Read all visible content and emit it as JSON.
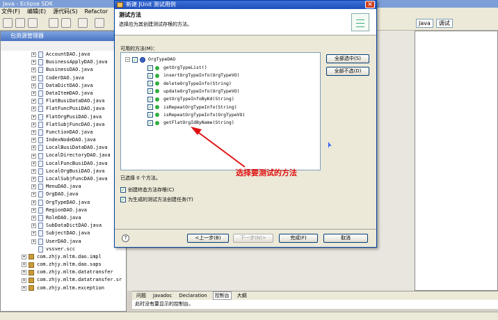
{
  "window": {
    "title": "Java - Eclipse SDK"
  },
  "menubar": [
    "文件(F)",
    "编辑(E)",
    "源代码(S)",
    "Refactor"
  ],
  "perspectives": {
    "java": "Java",
    "debug": "调试"
  },
  "explorer": {
    "tab": "包资源管理器",
    "files": [
      "AccountDAO.java",
      "BusinessApplyDAO.java",
      "BusinessDAO.java",
      "CoderDAO.java",
      "DataDictDAO.java",
      "DataItemDAO.java",
      "FlatBusiDataDAO.java",
      "FlatFuncPusiDAO.java",
      "FlatOrgPusiDAO.java",
      "FlatSubjFuncDAO.java",
      "FunctionDAO.java",
      "IndexNodeDAO.java",
      "LocalBusiDataDAO.java",
      "LocalDirectoryDAO.java",
      "LocalFuncBusiDAO.java",
      "LocalOrgBusiDAO.java",
      "LocalSubjFuncDAO.java",
      "MenuDAO.java",
      "OrgDAO.java",
      "OrgTypeDAO.java",
      "RegionDAO.java",
      "RoleDAO.java",
      "SubDataDictDAO.java",
      "SubjectDAO.java",
      "UserDAO.java"
    ],
    "extra_file": "vssver.scc",
    "packages": [
      "com.zhjy.mltm.dao.impl",
      "com.zhjy.mltm.dao.saps",
      "com.zhjy.mltm.datatransfer",
      "com.zhjy.mltm.datatransfer.sr",
      "com.zhjy.mltm.exception"
    ]
  },
  "dialog": {
    "title": "新建 JUnit 测试用例",
    "header_title": "测试方法",
    "header_sub": "选择应为其创建测试存根的方法。",
    "methods_label": "可用的方法(M)：",
    "class_node": "OrgTypeDAO",
    "methods": [
      "getOrgTypeList()",
      "insertOrgTypeInfo(OrgTypeVO)",
      "deleteOrgTypeInfo(String)",
      "updateOrgTypeInfo(OrgTypeVO)",
      "getOrgTypeInfoByKd(String)",
      "isRepeatOrgTypeInfo(String)",
      "isRepeatOrgTypeInfo(OrgTypeVO)",
      "getFlatOrgIdByName(String)"
    ],
    "select_all": "全部选中(S)",
    "deselect_all": "全部不选(D)",
    "selected_count": "已选择 0 个方法。",
    "opt_final": "创建终态方法存根(C)",
    "opt_tasks": "为生成的测试方法创建任务(T)",
    "back": "<上一步(B)",
    "next": "下一步(N)>",
    "finish": "完成(F)",
    "cancel": "取消",
    "annotation": "选择要测试的方法"
  },
  "console": {
    "tabs": [
      "问题",
      "Javadoc",
      "Declaration",
      "控制台",
      "大纲"
    ],
    "body": "此时没有要显示的控制台。"
  }
}
